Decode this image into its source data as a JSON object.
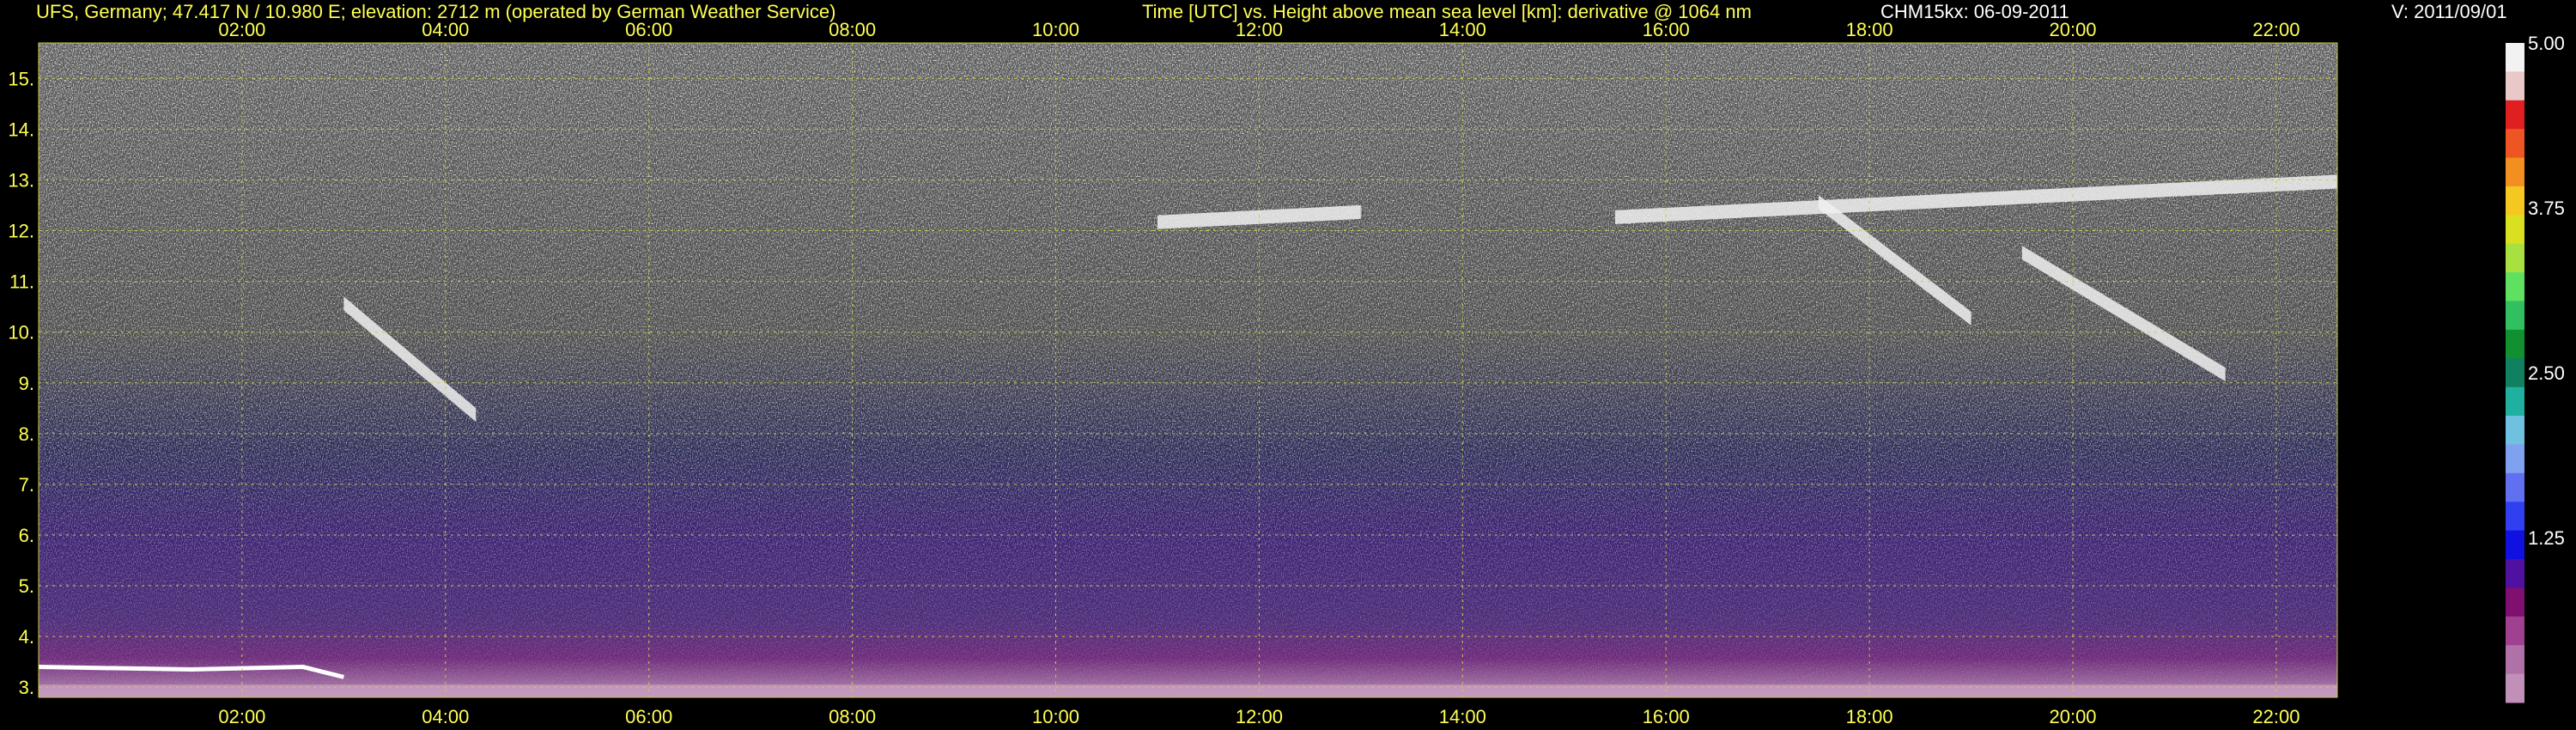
{
  "header": {
    "station": "UFS, Germany; 47.417 N / 10.980 E; elevation: 2712 m  (operated by German Weather Service)",
    "description": "Time [UTC] vs. Height above mean sea level [km]: derivative @ 1064 nm",
    "instrument_date": "CHM15kx: 06-09-2011",
    "version": "V: 2011/09/01"
  },
  "colors": {
    "background": "#000000",
    "text": "#ffff55",
    "grid": "#cccc44",
    "header_white": "#ffffff",
    "colorbar_top_to_bottom": [
      "#f2f2f2",
      "#e8c8c8",
      "#e02020",
      "#ee5522",
      "#f19020",
      "#f4c820",
      "#d8e020",
      "#a8e040",
      "#60e060",
      "#30c060",
      "#109030",
      "#108060",
      "#20b0a0",
      "#70c0e0",
      "#80a0f0",
      "#6070f0",
      "#3040f0",
      "#1010e0",
      "#5010a0",
      "#801070",
      "#a04090",
      "#b070a8",
      "#c090b8"
    ]
  },
  "chart_data": {
    "type": "heatmap",
    "title": "Time [UTC] vs. Height above mean sea level [km]: derivative @ 1064 nm",
    "xlabel": "",
    "ylabel": "",
    "x_ticks": [
      "02:00",
      "04:00",
      "06:00",
      "08:00",
      "10:00",
      "12:00",
      "14:00",
      "16:00",
      "18:00",
      "20:00",
      "22:00"
    ],
    "x_tick_hours": [
      2,
      4,
      6,
      8,
      10,
      12,
      14,
      16,
      18,
      20,
      22
    ],
    "xlim_hours": [
      0.0,
      22.6
    ],
    "y_ticks": [
      "3",
      "4",
      "5",
      "6",
      "7",
      "8",
      "9",
      "10",
      "11",
      "12",
      "13",
      "14",
      "15"
    ],
    "y_tick_values": [
      3,
      4,
      5,
      6,
      7,
      8,
      9,
      10,
      11,
      12,
      13,
      14,
      15
    ],
    "ylim_km": [
      2.8,
      15.7
    ],
    "grid": true,
    "colorbar": {
      "ticks": [
        "5.00",
        "3.75",
        "2.50",
        "1.25"
      ],
      "tick_values": [
        5.0,
        3.75,
        2.5,
        1.25
      ],
      "range": [
        0,
        5.0
      ]
    },
    "cloud_layers": [
      {
        "start_hour": 3.0,
        "end_hour": 4.3,
        "base_km_start": 10.6,
        "base_km_end": 8.4
      },
      {
        "start_hour": 11.0,
        "end_hour": 13.0,
        "base_km_start": 12.2,
        "base_km_end": 12.4
      },
      {
        "start_hour": 15.5,
        "end_hour": 22.6,
        "base_km_start": 12.3,
        "base_km_end": 13.0
      },
      {
        "start_hour": 17.5,
        "end_hour": 19.0,
        "base_km_start": 12.6,
        "base_km_end": 10.3
      },
      {
        "start_hour": 19.5,
        "end_hour": 21.5,
        "base_km_start": 11.6,
        "base_km_end": 9.2
      }
    ]
  }
}
